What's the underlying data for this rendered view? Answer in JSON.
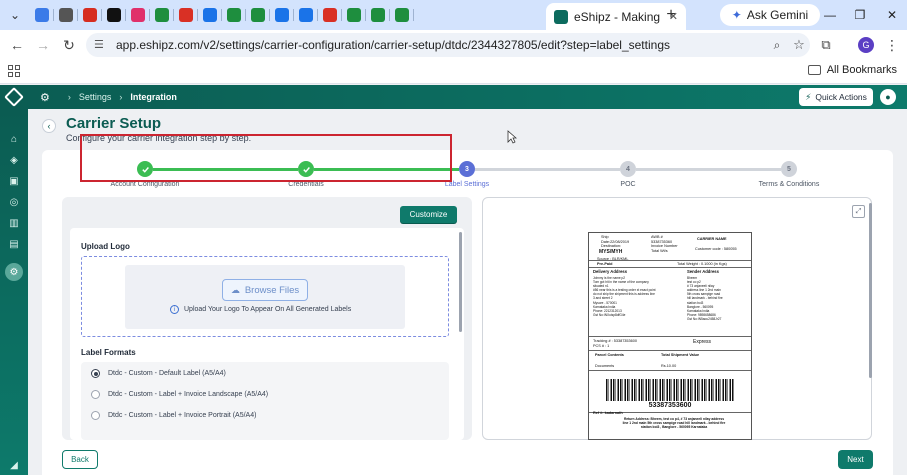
{
  "browser": {
    "active_tab_title": "eShipz - Making",
    "ask_gemini": "Ask Gemini",
    "url": "app.eshipz.com/v2/settings/carrier-configuration/carrier-setup/dtdc/2344327805/edit?step=label_settings",
    "all_bookmarks": "All Bookmarks",
    "profile_initial": "G",
    "pinned_tab_colors": [
      "#3b7be8",
      "#555555",
      "#d62d20",
      "#111111",
      "#e0306a",
      "#1e8e3e",
      "#d93025",
      "#1a73e8",
      "#1e8e3e",
      "#1e8e3e",
      "#1a73e8",
      "#1a73e8",
      "#d93025",
      "#1e8e3e",
      "#1e8e3e",
      "#1e8e3e"
    ]
  },
  "app": {
    "breadcrumb": [
      "Settings",
      "Integration"
    ],
    "quick_actions": "Quick Actions",
    "brand_color": "#0b5c52"
  },
  "page": {
    "title": "Carrier Setup",
    "subtitle": "Configure your carrier integration step by step."
  },
  "steps": [
    {
      "number": "",
      "label": "Account Configuration",
      "state": "done"
    },
    {
      "number": "",
      "label": "Credentials",
      "state": "done"
    },
    {
      "number": "3",
      "label": "Label Settings",
      "state": "current"
    },
    {
      "number": "4",
      "label": "POC",
      "state": "todo"
    },
    {
      "number": "5",
      "label": "Terms & Conditions",
      "state": "todo"
    }
  ],
  "left": {
    "customize": "Customize",
    "upload_logo": "Upload Logo",
    "browse_files": "Browse Files",
    "upload_hint": "Upload Your Logo To Appear On All Generated Labels",
    "label_formats_title": "Label Formats",
    "formats": [
      {
        "label": "Dtdc - Custom - Default Label (A5/A4)",
        "selected": true
      },
      {
        "label": "Dtdc - Custom - Label + Invoice Landscape (A5/A4)",
        "selected": false
      },
      {
        "label": "Dtdc - Custom - Label + Invoice Portrait (A5/A4)",
        "selected": false
      }
    ]
  },
  "label_preview": {
    "ship_date": "Ship\nDate:22/08/2019\nDestination:",
    "dest_code": "MYS/MYH",
    "source": "Source : BLR/KML",
    "awb_block": "AWB #\n5338735360\nInvoice Number\nTotal Wt/s",
    "carrier": "CARRIER NAME",
    "customer_code": "Customer code : 580055",
    "prepaid": "Pre-Paid",
    "total_weight": "Total Weight : 0.1000 (in Kgs)",
    "delivery_title": "Delivery Address",
    "delivery_text": "Johnny is the name p2\nTom got hit in the name of the company\nsituated n1\n#56 near this is a testing order xt exact point\ndo not ship the shipment this is address line\n3 and street 2\nMysore - 570001\nKarnataka India\nPhone: 2212312013\nGst No:INXuisp8dfG4e",
    "sender_title": "Sender Address",
    "sender_text": "Bheem\ntest co p2\n# 73 anjaneeli nilay\naddress line 1 2nd main\n5th cross sampige road\nhill landmark - behind fire\nstation bol3\nBanglore - 560095\nKarnataka India\nPhone: 9898658686\nGst No:IN5aou2458Jr27",
    "tracking": "Tracking # : 53387353600\nPCS # : 1",
    "express": "Express",
    "parcel_contents": "Parcel Contents",
    "total_value": "Total Shipment Value",
    "doc_type": "Documents",
    "amount": "Rs.10.00",
    "awb_number": "53387353600",
    "ref": "Ref #: kadarnath",
    "return_text": "Return Address: Bheem, test co p4, # 73 anjaneeli nilay address\nline 1 2nd main 5th cross sampige road hill landmark - behind fire\nstation bol3 , Banglore - 560095 Karnataka"
  },
  "footer": {
    "back": "Back",
    "next": "Next"
  }
}
